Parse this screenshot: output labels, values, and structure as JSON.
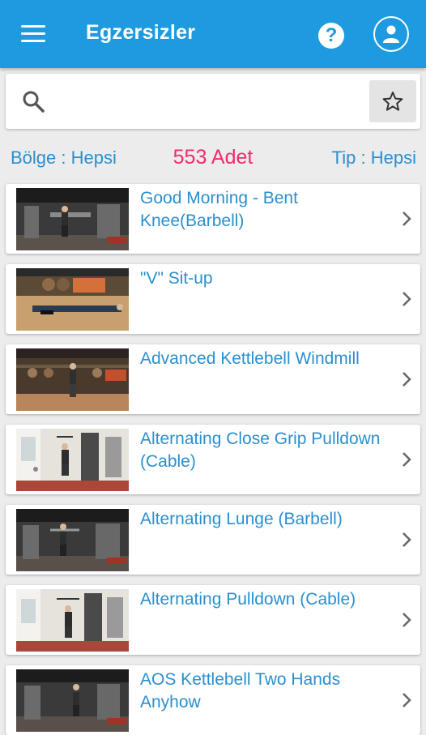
{
  "appbar": {
    "title": "Egzersizler",
    "menu_icon": "menu-icon",
    "help_icon": "help-icon",
    "help_glyph": "?",
    "profile_icon": "person-icon"
  },
  "search": {
    "placeholder": "",
    "value": "",
    "favorite_icon": "star-icon"
  },
  "filters": {
    "region_label": "Bölge : Hepsi",
    "count_label": "553 Adet",
    "type_label": "Tip : Hepsi"
  },
  "exercises": [
    {
      "title": " Good Morning - Bent Knee(Barbell)",
      "thumb": "gym-room"
    },
    {
      "title": "\"V\" Sit-up",
      "thumb": "floor-mat"
    },
    {
      "title": "Advanced Kettlebell Windmill",
      "thumb": "studio"
    },
    {
      "title": "Alternating Close Grip Pulldown (Cable)",
      "thumb": "bright-room"
    },
    {
      "title": "Alternating Lunge (Barbell)",
      "thumb": "gym-room"
    },
    {
      "title": "Alternating Pulldown (Cable)",
      "thumb": "bright-room"
    },
    {
      "title": "AOS Kettlebell Two Hands Anyhow",
      "thumb": "gym-room"
    }
  ],
  "colors": {
    "appbar": "#1e9be0",
    "accent_text": "#2a8fd0",
    "count": "#ec2d6c"
  }
}
